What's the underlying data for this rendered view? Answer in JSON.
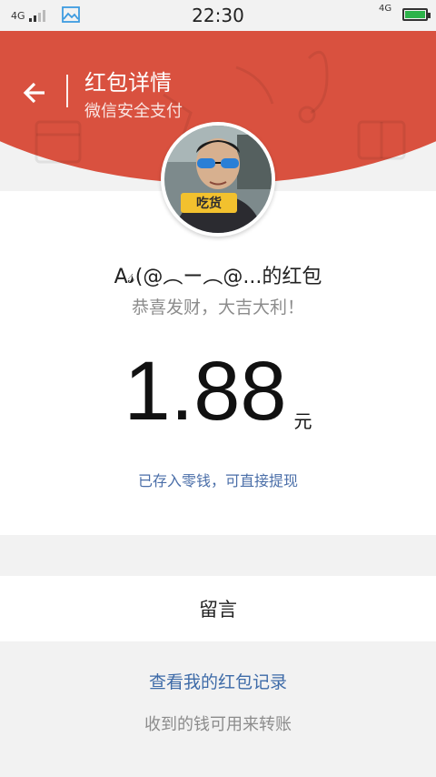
{
  "status_bar": {
    "network_left": "4G",
    "network_right": "4G",
    "time": "22:30",
    "battery_level": 1.0,
    "signal_icon": "signal-bars-icon",
    "gallery_icon": "image-icon"
  },
  "header": {
    "back_icon": "arrow-left-icon",
    "title": "红包详情",
    "subtitle": "微信安全支付",
    "accent_color": "#d9513f"
  },
  "packet": {
    "sender": "A𝓈(@︵ー︵@...的红包",
    "wish": "恭喜发财，大吉大利！",
    "amount": "1.88",
    "unit": "元",
    "saved_note": "已存入零钱，可直接提现"
  },
  "message": {
    "label": "留言"
  },
  "footer": {
    "record_link": "查看我的红包记录",
    "note": "收到的钱可用来转账"
  }
}
